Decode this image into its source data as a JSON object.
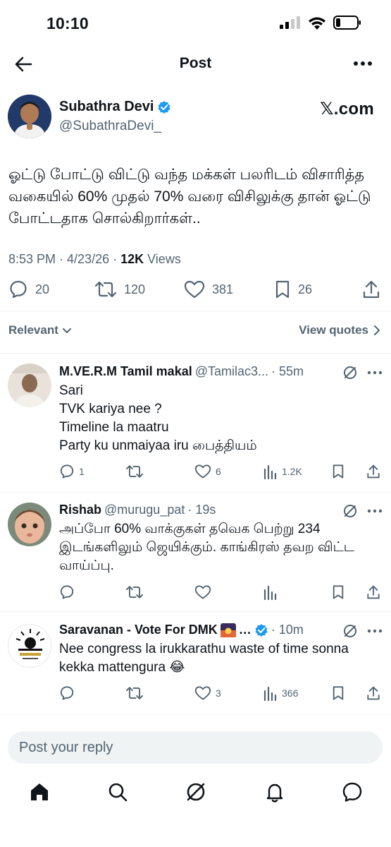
{
  "status": {
    "time": "10:10"
  },
  "header": {
    "title": "Post"
  },
  "post": {
    "author_name": "Subathra Devi",
    "author_handle": "@SubathraDevi_",
    "source_brand": "𝕏.com",
    "text": "ஓட்டு போட்டு விட்டு வந்த மக்கள் பலரிடம் விசாரித்த வகையில் 60% முதல் 70% வரை விசிலுக்கு தான் ஓட்டு போட்டதாக சொல்கிறார்கள்..",
    "time_date": "8:53 PM · 4/23/26 · ",
    "views_count": "12K",
    "views_label": " Views",
    "replies": "20",
    "reposts": "120",
    "likes": "381",
    "bookmarks": "26"
  },
  "filters": {
    "relevant": "Relevant",
    "view_quotes": "View quotes"
  },
  "replies": [
    {
      "name": "M.VE.R.M Tamil makal",
      "handle": "@Tamilac3...",
      "time": "· 55m",
      "lines": [
        "Sari",
        "TVK kariya nee ?",
        "Timeline la maatru",
        "Party ku unmaiyaa iru பைத்தியம்"
      ],
      "reply_count": "1",
      "repost_count": "",
      "like_count": "6",
      "view_count": "1.2K"
    },
    {
      "name": "Rishab",
      "handle": "@murugu_pat",
      "time": "· 19s",
      "lines": [
        "அப்போ 60% வாக்குகள் தவெக பெற்று 234",
        "இடங்களிலும் ஜெயிக்கும். காங்கிரஸ் தவற விட்ட",
        "வாய்ப்பு."
      ],
      "reply_count": "",
      "repost_count": "",
      "like_count": "",
      "view_count": ""
    },
    {
      "name": "Saravanan - Vote For DMK",
      "name_suffix": "…",
      "time": "· 10m",
      "lines": [
        "Nee congress la irukkarathu waste of time sonna",
        "kekka mattengura 😂"
      ],
      "reply_count": "",
      "repost_count": "",
      "like_count": "3",
      "view_count": "366"
    }
  ],
  "compose": {
    "placeholder": "Post your reply"
  },
  "colors": {
    "accent": "#1d9bf0",
    "text": "#0f1419",
    "muted": "#536471",
    "divider": "#eff3f4"
  }
}
